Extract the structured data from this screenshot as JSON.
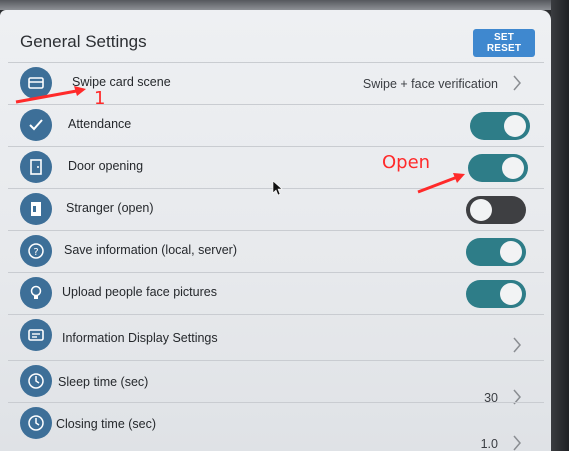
{
  "header": {
    "title": "General Settings",
    "reset_label": "SET RESET"
  },
  "rows": [
    {
      "label": "Swipe card scene",
      "value": "Swipe + face verification",
      "control": "chevron",
      "icon": "card-icon"
    },
    {
      "label": "Attendance",
      "control": "toggle",
      "state": "on",
      "icon": "check-icon"
    },
    {
      "label": "Door opening",
      "control": "toggle",
      "state": "on",
      "icon": "door-icon"
    },
    {
      "label": "Stranger (open)",
      "control": "toggle",
      "state": "off",
      "icon": "stranger-door-icon"
    },
    {
      "label": "Save information (local, server)",
      "control": "toggle",
      "state": "on",
      "icon": "question-icon"
    },
    {
      "label": "Upload people face pictures",
      "control": "toggle",
      "state": "on",
      "icon": "lightbulb-icon"
    },
    {
      "label": "Information Display Settings",
      "control": "chevron",
      "icon": "display-icon"
    },
    {
      "label": "Sleep time (sec)",
      "value": "30",
      "control": "chevron",
      "icon": "clock-icon"
    },
    {
      "label": "Closing time (sec)",
      "value": "1.0",
      "control": "chevron",
      "icon": "clock-icon"
    }
  ],
  "annotations": {
    "marker_1": "1",
    "open_note": "Open"
  },
  "colors": {
    "toggle_on": "#2e7d88",
    "toggle_off": "#3e3f42",
    "accent_button": "#3f88cf",
    "annotation": "#ff2a2a"
  }
}
